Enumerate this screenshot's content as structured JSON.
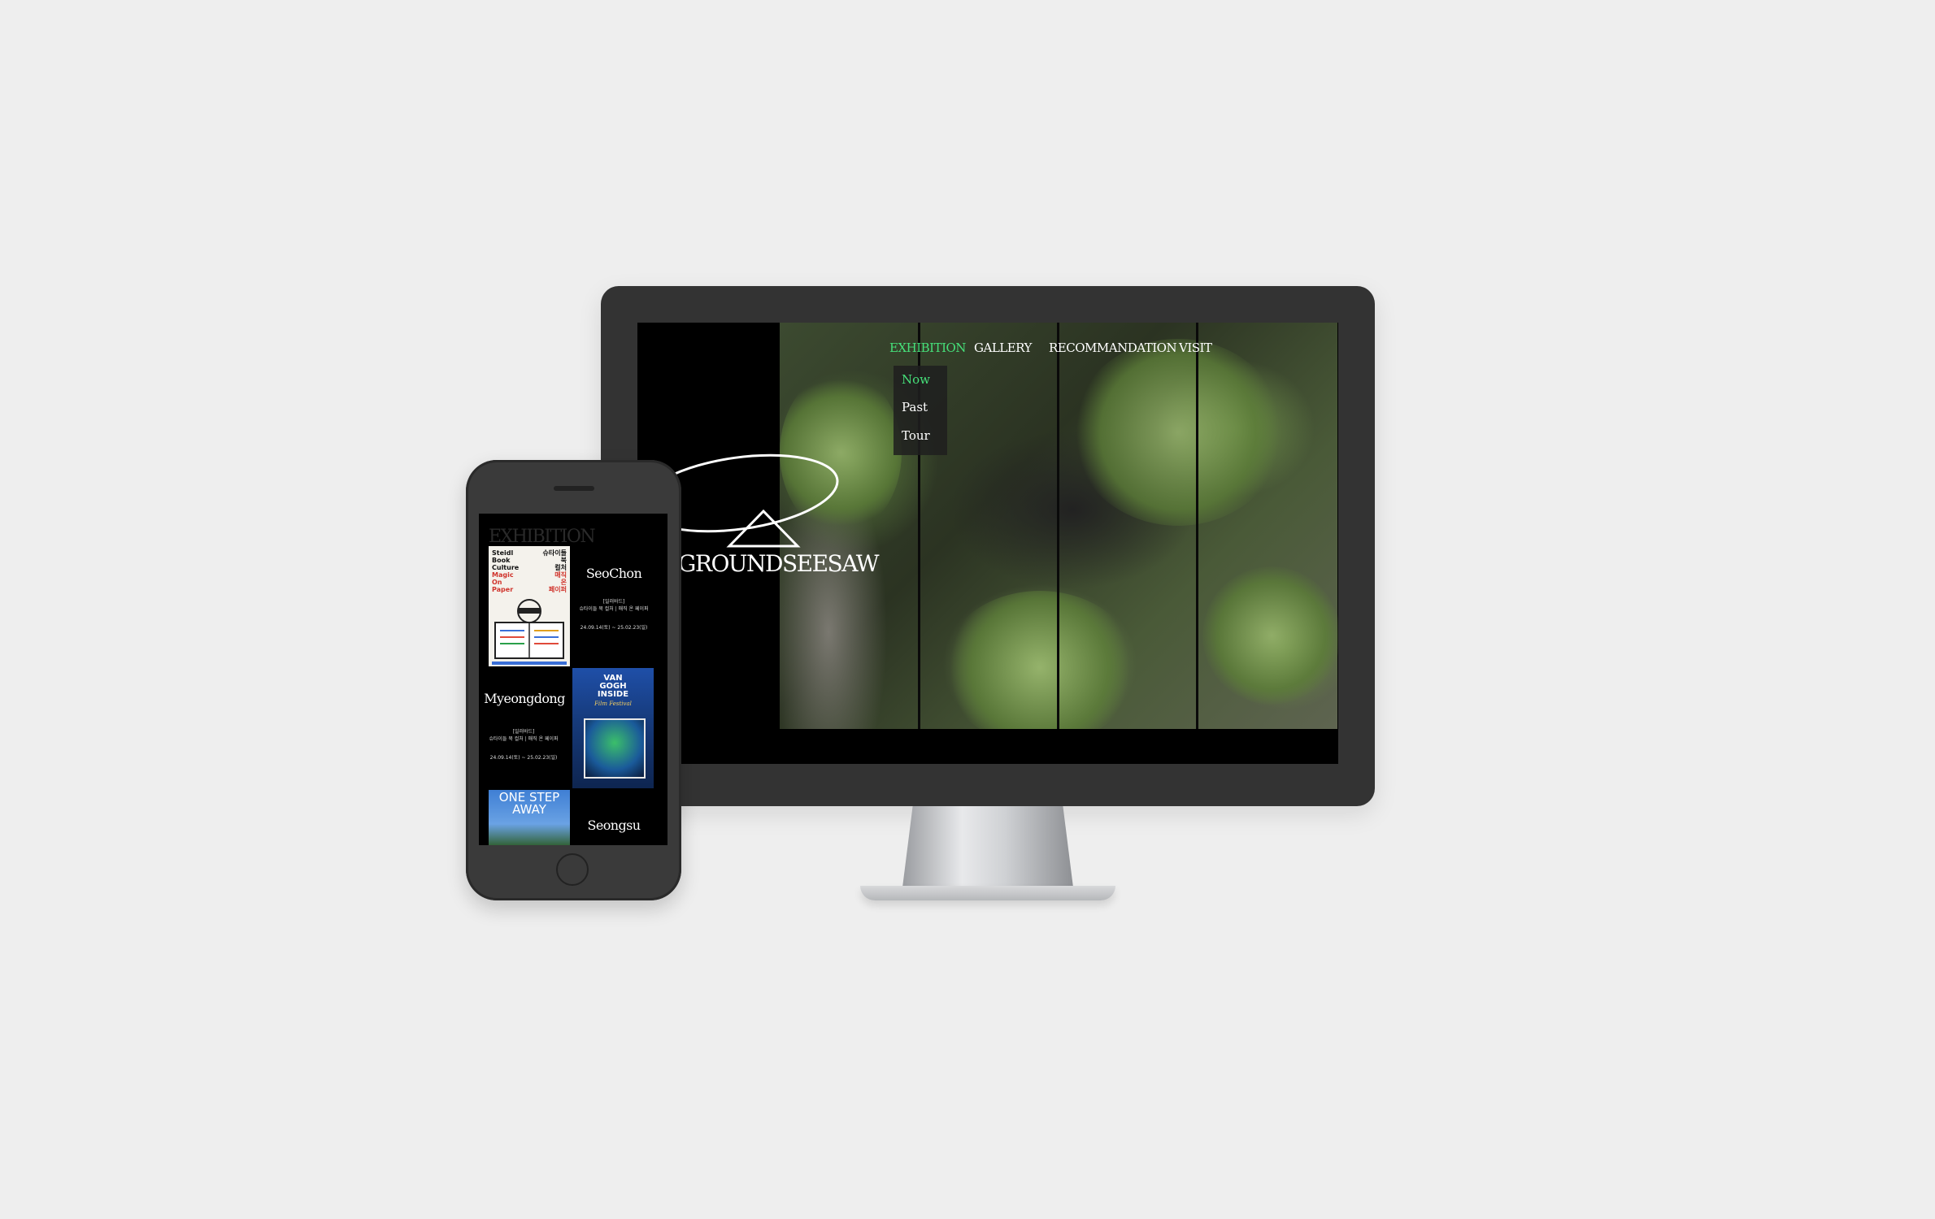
{
  "desktop": {
    "nav": [
      {
        "label": "EXHIBITION",
        "active": true
      },
      {
        "label": "GALLERY",
        "active": false
      },
      {
        "label": "RECOMMANDATION",
        "active": false
      },
      {
        "label": "VISIT",
        "active": false
      }
    ],
    "submenu": [
      {
        "label": "Now",
        "active": true
      },
      {
        "label": "Past",
        "active": false
      },
      {
        "label": "Tour",
        "active": false
      }
    ],
    "logo_text": "GROUNDSEESAW"
  },
  "mobile": {
    "heading": "EXHIBITION",
    "cards": [
      {
        "title": "SeoChon",
        "subtitle_line1": "[일러바드]",
        "subtitle_line2": "슈타이들 북 컬처 | 매직 온 페이퍼",
        "date": "24.09.14(토) ~ 25.02.23(일)",
        "poster_lines": [
          "Steidl",
          "Book",
          "Culture",
          "Magic",
          "On",
          "Paper"
        ],
        "poster_kr": [
          "슈타이들",
          "북",
          "컬처",
          "매직",
          "온",
          "페이퍼"
        ]
      },
      {
        "title": "Myeongdong",
        "subtitle_line1": "[일러바드]",
        "subtitle_line2": "슈타이들 북 컬처 | 매직 온 페이퍼",
        "date": "24.09.14(토) ~ 25.02.23(일)",
        "poster_lines": [
          "VAN",
          "GOGH",
          "INSIDE"
        ],
        "poster_script": "Film Festival"
      },
      {
        "title": "Seongsu",
        "poster_lines": [
          "ONE STEP",
          "AWAY"
        ]
      }
    ]
  },
  "colors": {
    "accent": "#46e07a",
    "background": "#eeeeee",
    "device": "#333333"
  }
}
